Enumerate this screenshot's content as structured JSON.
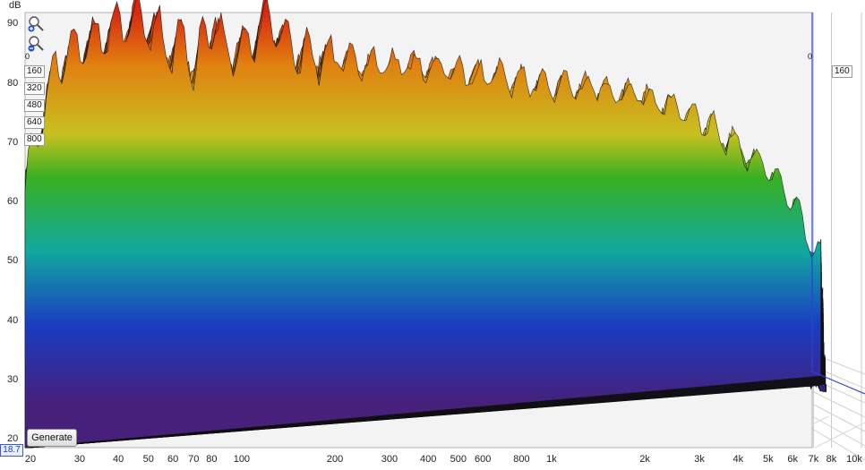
{
  "chart_data": {
    "type": "waterfall-3d",
    "y_unit": "dB",
    "y_ticks": [
      "90",
      "80",
      "70",
      "60",
      "50",
      "40",
      "30",
      "20"
    ],
    "x_ticks": [
      "20",
      "30",
      "40",
      "50",
      "60",
      "70",
      "80",
      "100",
      "200",
      "300",
      "400",
      "500",
      "600",
      "800",
      "1k",
      "2k",
      "3k",
      "4k",
      "5k",
      "6k",
      "7k",
      "8k",
      "10k"
    ],
    "x_scale": "log",
    "xlim": [
      20,
      10000
    ],
    "ylim": [
      18.7,
      92
    ],
    "time_ticks": [
      "0",
      "160",
      "320",
      "480",
      "640",
      "800"
    ],
    "right_time_ticks": [
      "0",
      "160"
    ],
    "floor_value": "18.7",
    "peak_profile": [
      {
        "f": 20,
        "db": 63
      },
      {
        "f": 25,
        "db": 83
      },
      {
        "f": 30,
        "db": 86
      },
      {
        "f": 35,
        "db": 88
      },
      {
        "f": 40,
        "db": 90
      },
      {
        "f": 45,
        "db": 91
      },
      {
        "f": 50,
        "db": 90
      },
      {
        "f": 55,
        "db": 88
      },
      {
        "f": 60,
        "db": 85
      },
      {
        "f": 65,
        "db": 88
      },
      {
        "f": 70,
        "db": 82
      },
      {
        "f": 80,
        "db": 91
      },
      {
        "f": 90,
        "db": 85
      },
      {
        "f": 100,
        "db": 86
      },
      {
        "f": 120,
        "db": 91
      },
      {
        "f": 150,
        "db": 85
      },
      {
        "f": 200,
        "db": 84
      },
      {
        "f": 300,
        "db": 83
      },
      {
        "f": 400,
        "db": 83
      },
      {
        "f": 500,
        "db": 82
      },
      {
        "f": 700,
        "db": 81
      },
      {
        "f": 1000,
        "db": 80
      },
      {
        "f": 1500,
        "db": 79
      },
      {
        "f": 2000,
        "db": 78
      },
      {
        "f": 3000,
        "db": 74
      },
      {
        "f": 4000,
        "db": 70
      },
      {
        "f": 5000,
        "db": 65
      },
      {
        "f": 6000,
        "db": 60
      },
      {
        "f": 7000,
        "db": 52
      }
    ],
    "colors": {
      "high": "#d62a10",
      "upper": "#e08010",
      "mid_high": "#c8c020",
      "mid": "#38b020",
      "mid_low": "#10a8a0",
      "low": "#1a3cc0",
      "floor": "#46207a",
      "grid": "#c8c8c8",
      "axis": "#3040d0"
    }
  },
  "controls": {
    "generate_label": "Generate",
    "zoom_in_icon": "zoom-in-icon",
    "zoom_out_icon": "zoom-out-icon"
  }
}
